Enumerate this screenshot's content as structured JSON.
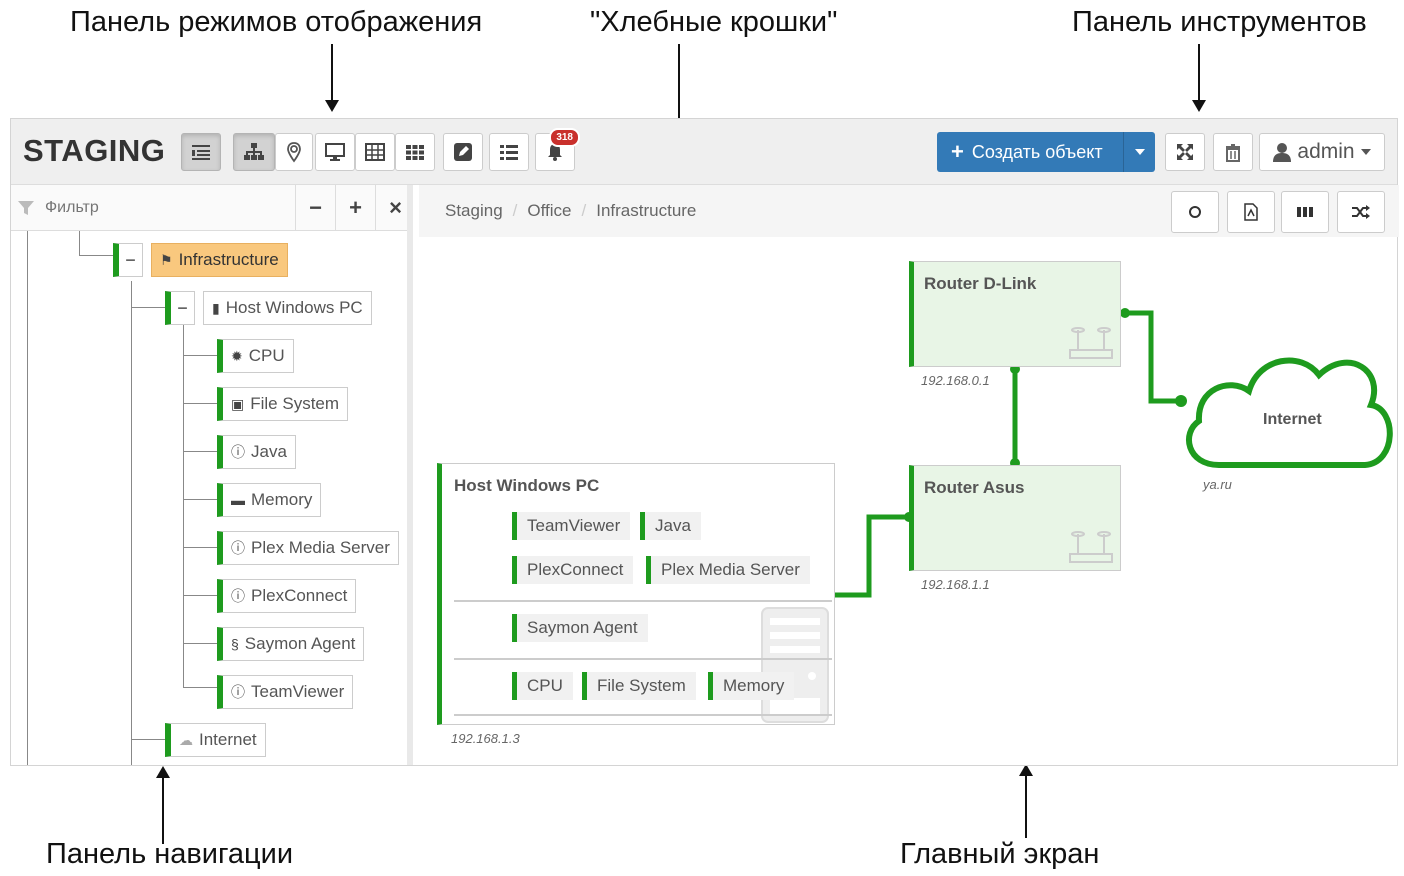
{
  "annotations": {
    "view_modes": "Панель режимов отображения",
    "breadcrumbs": "\"Хлебные крошки\"",
    "toolbar": "Панель инструментов",
    "navigation": "Панель навигации",
    "main_screen": "Главный экран"
  },
  "app": {
    "title": "STAGING",
    "notifications_count": "318",
    "create_button": "Создать объект",
    "user": "admin"
  },
  "sidebar": {
    "filter_placeholder": "Фильтр",
    "tree": [
      {
        "label": "Infrastructure",
        "icon": "sitemap-icon",
        "level": 0,
        "selected": true
      },
      {
        "label": "Host Windows PC",
        "icon": "server-icon",
        "level": 1
      },
      {
        "label": "CPU",
        "icon": "cpu-icon",
        "level": 2
      },
      {
        "label": "File System",
        "icon": "hdd-icon",
        "level": 2
      },
      {
        "label": "Java",
        "icon": "info-icon",
        "level": 2
      },
      {
        "label": "Memory",
        "icon": "memory-icon",
        "level": 2
      },
      {
        "label": "Plex Media Server",
        "icon": "info-icon",
        "level": 2
      },
      {
        "label": "PlexConnect",
        "icon": "info-icon",
        "level": 2
      },
      {
        "label": "Saymon Agent",
        "icon": "agent-icon",
        "level": 2
      },
      {
        "label": "TeamViewer",
        "icon": "info-icon",
        "level": 2
      },
      {
        "label": "Internet",
        "icon": "cloud-icon",
        "level": 1
      }
    ]
  },
  "breadcrumbs": [
    "Staging",
    "Office",
    "Infrastructure"
  ],
  "canvas": {
    "host": {
      "title": "Host Windows PC",
      "ip": "192.168.1.3",
      "row1": [
        "TeamViewer",
        "Java"
      ],
      "row2": [
        "PlexConnect",
        "Plex Media Server"
      ],
      "row3": [
        "Saymon Agent"
      ],
      "row4": [
        "CPU",
        "File System",
        "Memory"
      ]
    },
    "router_dlink": {
      "title": "Router D-Link",
      "ip": "192.168.0.1"
    },
    "router_asus": {
      "title": "Router Asus",
      "ip": "192.168.1.1"
    },
    "internet": {
      "title": "Internet",
      "ip": "ya.ru"
    }
  },
  "colors": {
    "accent": "#1e9b1e",
    "primary": "#337ab7",
    "selected": "#f9c87e",
    "badge": "#c9302c"
  }
}
